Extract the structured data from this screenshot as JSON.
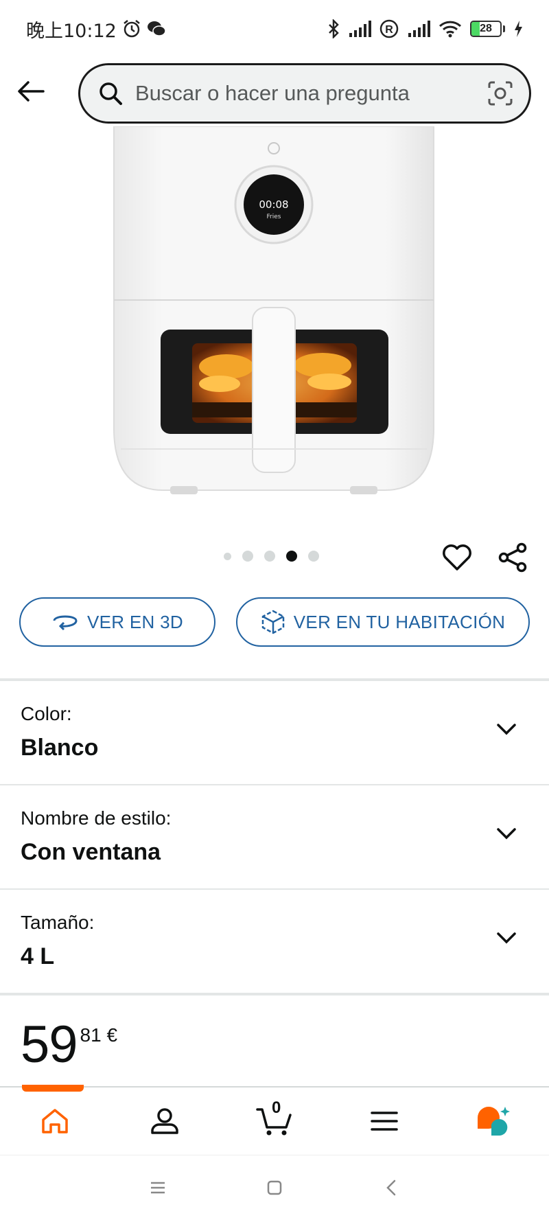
{
  "status_bar": {
    "time": "晚上10:12",
    "battery": "28"
  },
  "search": {
    "placeholder": "Buscar o hacer una pregunta"
  },
  "product": {
    "image_display": {
      "time": "00:08",
      "mode": "Fries"
    }
  },
  "carousel": {
    "total": 5,
    "active_index": 3
  },
  "view_buttons": {
    "view_3d": "VER EN 3D",
    "view_room": "VER EN TU HABITACIÓN"
  },
  "variations": [
    {
      "label": "Color:",
      "value": "Blanco"
    },
    {
      "label": "Nombre de estilo:",
      "value": "Con ventana"
    },
    {
      "label": "Tamaño:",
      "value": "4 L"
    }
  ],
  "price": {
    "whole": "59",
    "fraction": "81 €"
  },
  "bottom_nav": {
    "items": [
      "home-icon",
      "account-icon",
      "cart-icon",
      "menu-icon",
      "rufus-icon"
    ],
    "cart_count": "0",
    "active": "home",
    "accent_color": "#ff6200"
  },
  "colors": {
    "link": "#2162a1",
    "text": "#0f1111",
    "separator": "#e3e6e6"
  }
}
